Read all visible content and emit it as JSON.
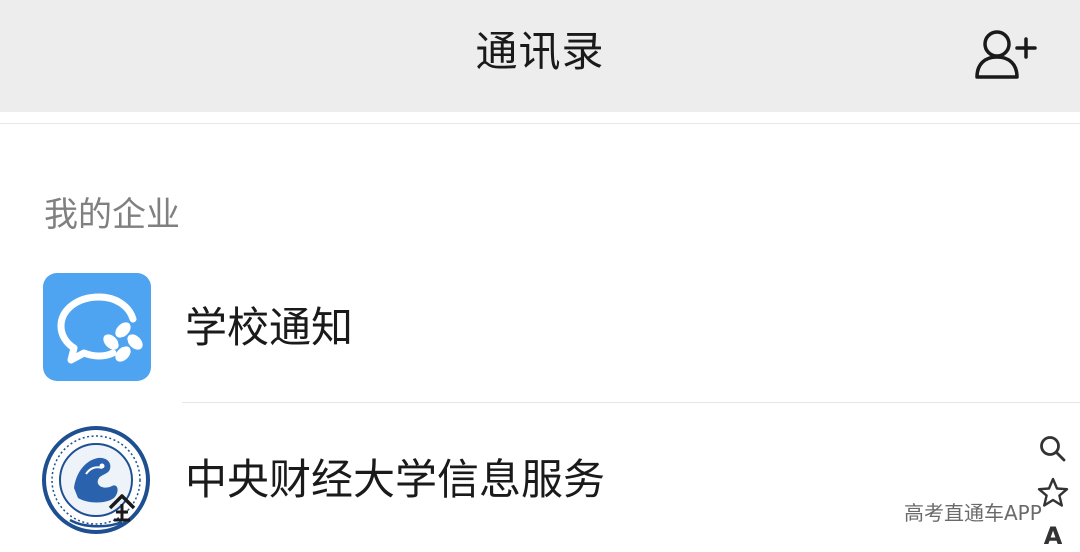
{
  "header": {
    "title": "通讯录",
    "add_contact_icon": "add-contact-icon"
  },
  "section": {
    "title": "我的企业"
  },
  "contacts": [
    {
      "name": "学校通知",
      "icon": "wecom-chat-icon",
      "icon_color": "#4ea4f0"
    },
    {
      "name": "中央财经大学信息服务",
      "icon": "university-seal-icon",
      "icon_color": "#1d4f91"
    }
  ],
  "index_bar": {
    "items": [
      "search-icon",
      "star-icon",
      "A"
    ]
  },
  "watermark": {
    "text": "高考直通车APP"
  }
}
